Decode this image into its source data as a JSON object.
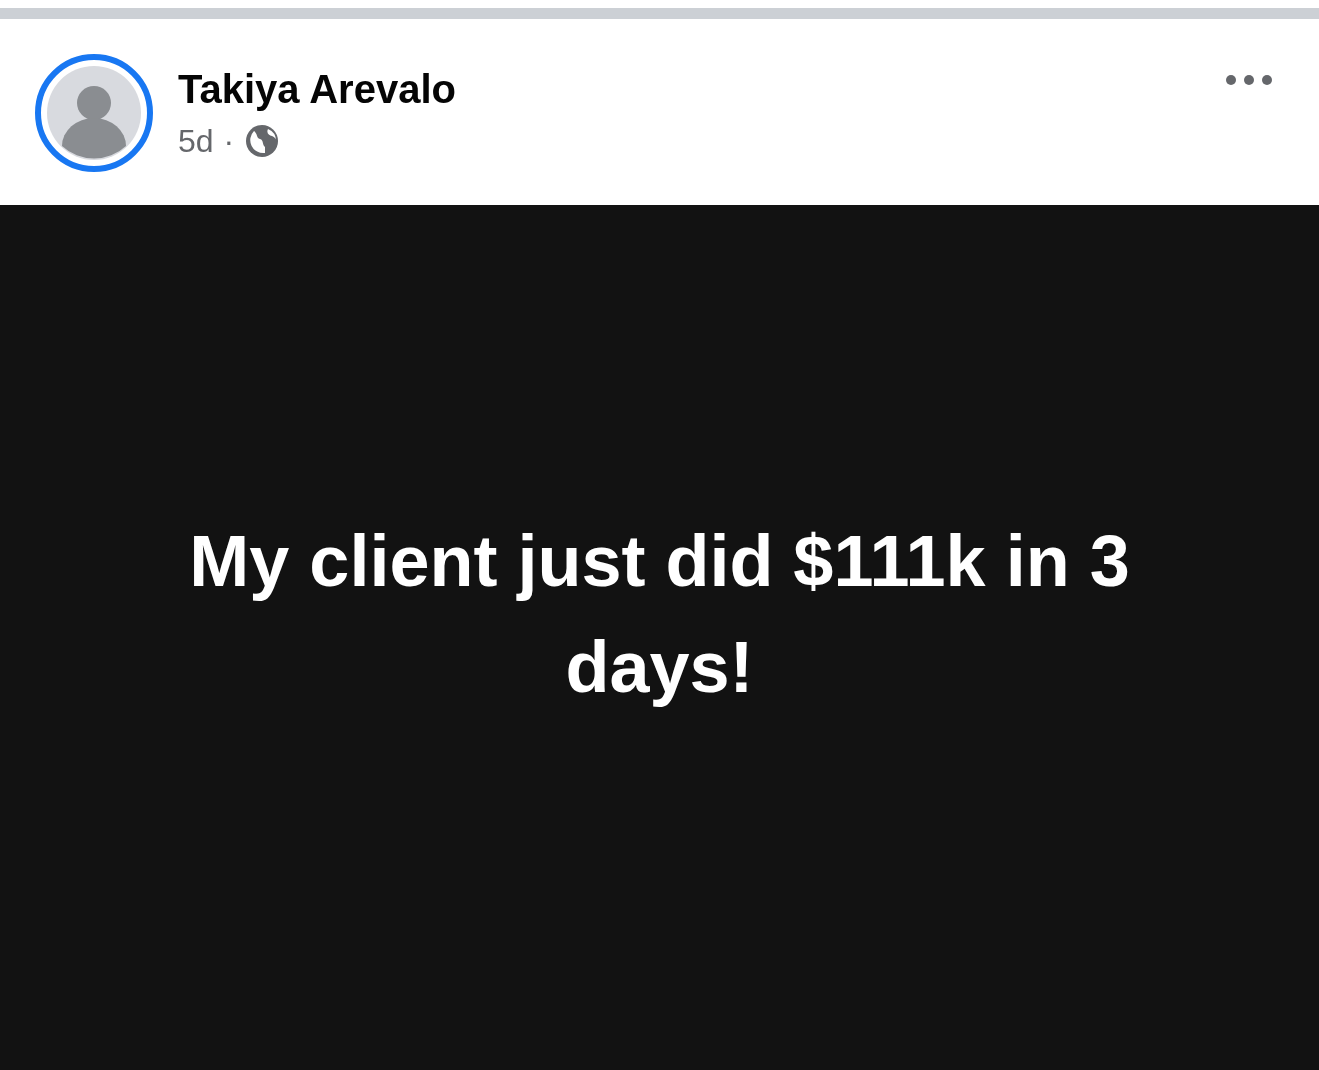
{
  "post": {
    "author": "Takiya Arevalo",
    "time": "5d",
    "separator": "·",
    "story_ring": true
  },
  "status_text": "My client just did $111k in 3 days!"
}
